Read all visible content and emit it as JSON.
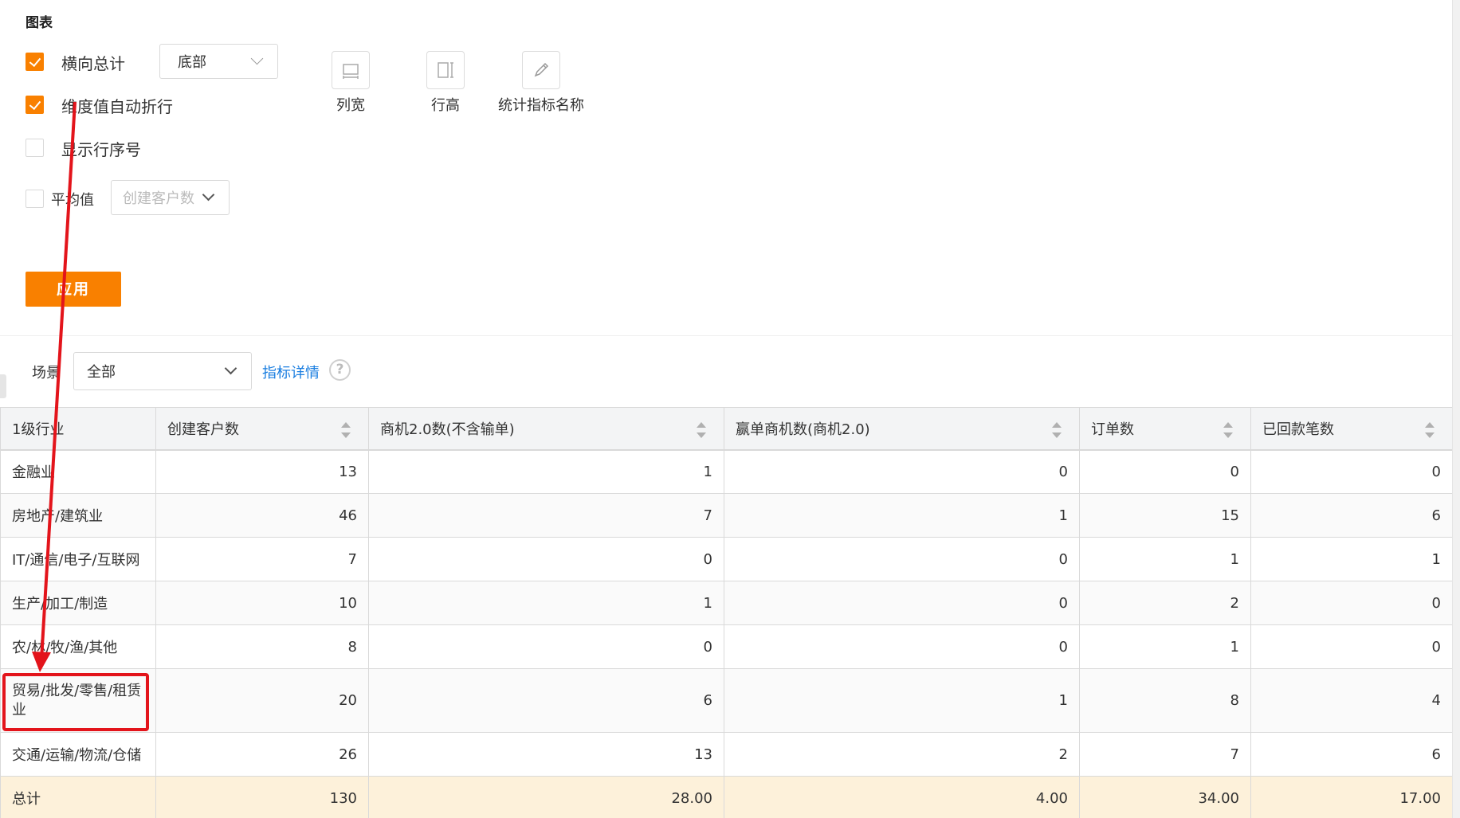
{
  "panel": {
    "title": "图表",
    "options": {
      "horizontal_total": {
        "label": "横向总计",
        "checked": true,
        "position_value": "底部"
      },
      "auto_wrap": {
        "label": "维度值自动折行",
        "checked": true
      },
      "show_row_number": {
        "label": "显示行序号",
        "checked": false
      },
      "average": {
        "label": "平均值",
        "checked": false,
        "metric_placeholder": "创建客户数"
      }
    },
    "tools": [
      {
        "label": "列宽",
        "icon": "column-width-icon"
      },
      {
        "label": "行高",
        "icon": "row-height-icon"
      },
      {
        "label": "统计指标名称",
        "icon": "pencil-icon"
      }
    ],
    "apply_label": "应用"
  },
  "filter": {
    "scene_label": "场景",
    "scene_value": "全部",
    "detail_link": "指标详情",
    "help_icon": "?"
  },
  "table": {
    "columns": [
      "1级行业",
      "创建客户数",
      "商机2.0数(不含输单)",
      "赢单商机数(商机2.0)",
      "订单数",
      "已回款笔数"
    ],
    "rows": [
      [
        "金融业",
        "13",
        "1",
        "0",
        "0",
        "0"
      ],
      [
        "房地产/建筑业",
        "46",
        "7",
        "1",
        "15",
        "6"
      ],
      [
        "IT/通信/电子/互联网",
        "7",
        "0",
        "0",
        "1",
        "1"
      ],
      [
        "生产/加工/制造",
        "10",
        "1",
        "0",
        "2",
        "0"
      ],
      [
        "农/林/牧/渔/其他",
        "8",
        "0",
        "0",
        "1",
        "0"
      ],
      [
        "贸易/批发/零售/租赁业",
        "20",
        "6",
        "1",
        "8",
        "4"
      ],
      [
        "交通/运输/物流/仓储",
        "26",
        "13",
        "2",
        "7",
        "6"
      ]
    ],
    "total": [
      "总计",
      "130",
      "28.00",
      "4.00",
      "34.00",
      "17.00"
    ]
  },
  "colors": {
    "accent": "#f98000",
    "link": "#1a7ee0",
    "annotation": "#e3141b",
    "total_bg": "#fdf1da"
  }
}
